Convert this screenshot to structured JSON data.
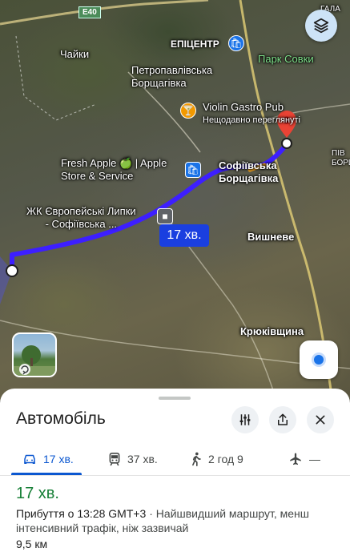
{
  "map": {
    "road_shield": "E40",
    "route_duration_badge": "17 хв.",
    "labels": {
      "chaiky": "Чайки",
      "petropavlivska": "Петропавлівська\nБорщагівка",
      "epicentr": "ЕПІЦЕНТР",
      "park_sovky": "Парк Совки",
      "violin_title": "Violin Gastro Pub",
      "violin_sub": "Нещодавно переглянуті",
      "fresh_apple": "Fresh Apple 🍏 | Apple\nStore & Service",
      "sofiivska": "Софіївська\nБорщагівка",
      "zhk": "ЖК Європейські Липки\n- Софіївська ...",
      "vyshneve": "Вишневе",
      "kriukivshchyna": "Крюківщина",
      "piv": "ПІВ\nБОРЩ",
      "hala": "ГАЛА"
    },
    "icons": {
      "layers": "layers-icon",
      "street_view": "street-view-icon",
      "my_location": "my-location-icon",
      "shopping": "shopping-bag-icon",
      "bar": "cocktail-icon",
      "destination": "destination-pin-icon"
    },
    "route_color": "#3d1fff",
    "destination_color": "#ea4335"
  },
  "sheet": {
    "title": "Автомобіль",
    "tabs": [
      {
        "icon": "car-icon",
        "label": "17 хв.",
        "active": true
      },
      {
        "icon": "transit-icon",
        "label": "37 хв.",
        "active": false
      },
      {
        "icon": "walk-icon",
        "label": "2 год 9",
        "active": false
      },
      {
        "icon": "flight-icon",
        "label": "—",
        "active": false
      }
    ],
    "duration": "17 хв.",
    "arrival": "Прибуття о 13:28 GMT+3",
    "separator": " · ",
    "description": "Найшвидший маршрут, менш інтенсивний трафік, ніж зазвичай",
    "distance": "9,5 км",
    "accent_color": "#0b57d0",
    "duration_color": "#188038"
  }
}
